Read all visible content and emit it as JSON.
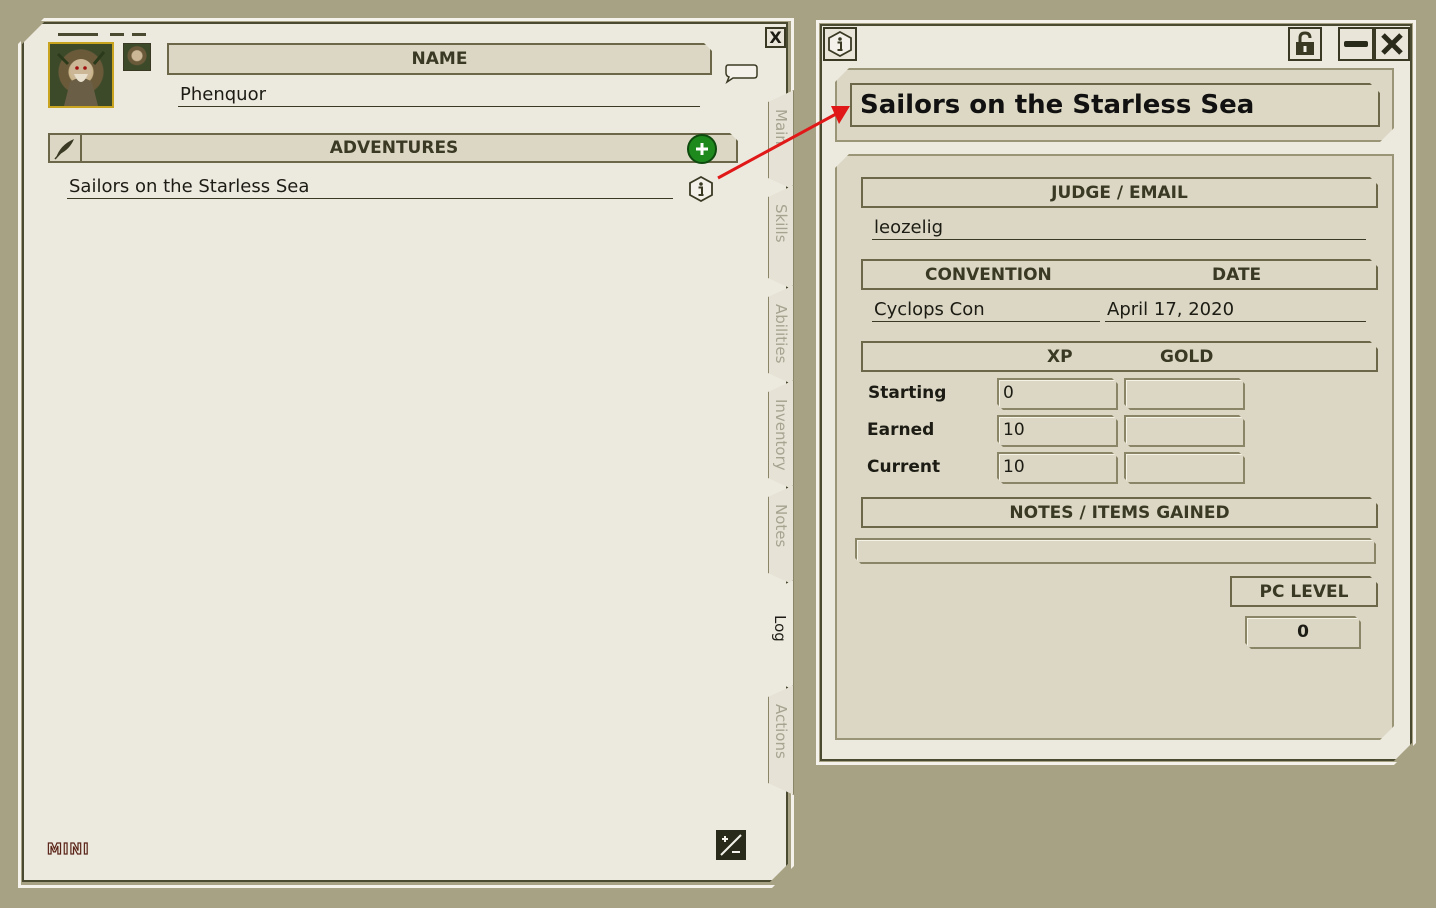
{
  "character_sheet": {
    "name_header": "NAME",
    "name_value": "Phenquor",
    "adventures_header": "ADVENTURES",
    "adventures": [
      {
        "title": "Sailors on the Starless Sea"
      }
    ],
    "mini_label": "MINI",
    "close_label": "X",
    "tabs": [
      "Main",
      "Skills",
      "Abilities",
      "Inventory",
      "Notes",
      "Log",
      "Actions"
    ],
    "active_tab": "Log"
  },
  "adventure_window": {
    "title": "Sailors on the Starless Sea",
    "judge_header": "JUDGE / EMAIL",
    "judge_value": "leozelig",
    "convention_header": "CONVENTION",
    "date_header": "DATE",
    "convention_value": "Cyclops Con",
    "date_value": "April 17, 2020",
    "xp_header": "XP",
    "gold_header": "GOLD",
    "rows": [
      {
        "label": "Starting",
        "xp": "0",
        "gold": ""
      },
      {
        "label": "Earned",
        "xp": "10",
        "gold": ""
      },
      {
        "label": "Current",
        "xp": "10",
        "gold": ""
      }
    ],
    "notes_header": "NOTES / ITEMS GAINED",
    "notes_value": "",
    "pc_level_header": "PC LEVEL",
    "pc_level_value": "0"
  },
  "colors": {
    "background": "#a8a285",
    "panel": "#ece9df",
    "bar": "#dcd7c4",
    "border": "#4a4a30",
    "add_button": "#1e8a1e",
    "arrow": "#e01818"
  }
}
